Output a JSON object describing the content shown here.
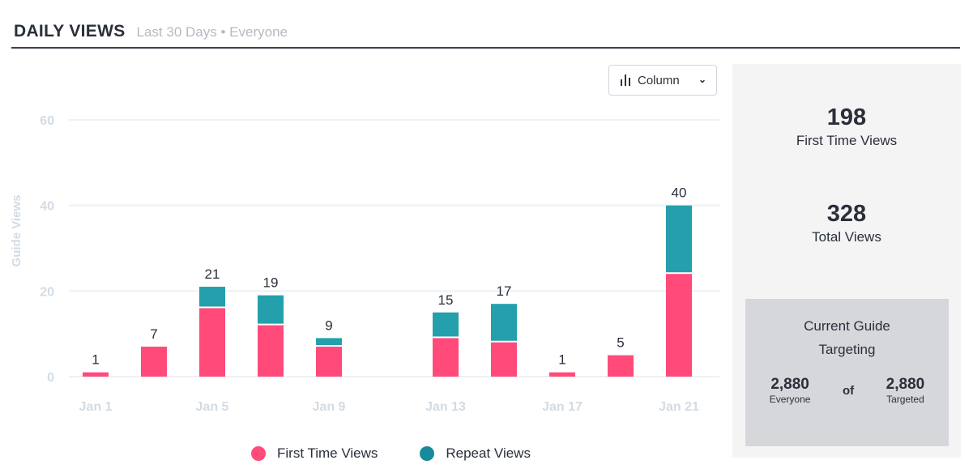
{
  "header": {
    "title": "DAILY VIEWS",
    "range": "Last 30 Days",
    "separator": "•",
    "audience": "Everyone"
  },
  "chart_type_dropdown": {
    "label": "Column",
    "icon": "bar-chart-icon"
  },
  "stats": {
    "first_time_views": "198",
    "first_time_label": "First Time Views",
    "total_views": "328",
    "total_label": "Total Views"
  },
  "targeting": {
    "title": "Current Guide Targeting",
    "everyone_count": "2,880",
    "everyone_label": "Everyone",
    "of": "of",
    "targeted_count": "2,880",
    "targeted_label": "Targeted"
  },
  "colors": {
    "first_time": "#ff4a7a",
    "repeat": "#24a0ad"
  },
  "chart_data": {
    "type": "bar",
    "stacked": true,
    "ylabel": "Guide Views",
    "ylim": [
      0,
      60
    ],
    "yticks": [
      0,
      20,
      40,
      60
    ],
    "grid": true,
    "x_ticks": [
      "Jan 1",
      "Jan 5",
      "Jan 9",
      "Jan 13",
      "Jan 17",
      "Jan 21"
    ],
    "categories": [
      "Jan 1",
      "Jan 3",
      "Jan 5",
      "Jan 7",
      "Jan 9",
      "Jan 13",
      "Jan 15",
      "Jan 17",
      "Jan 19",
      "Jan 21"
    ],
    "totals": [
      1,
      7,
      21,
      19,
      9,
      15,
      17,
      1,
      5,
      40
    ],
    "series": [
      {
        "name": "First Time Views",
        "values": [
          1,
          7,
          16,
          12,
          7,
          9,
          8,
          1,
          5,
          24
        ]
      },
      {
        "name": "Repeat Views",
        "values": [
          0,
          0,
          5,
          7,
          2,
          6,
          9,
          0,
          0,
          16
        ]
      }
    ],
    "legend": "bottom"
  }
}
